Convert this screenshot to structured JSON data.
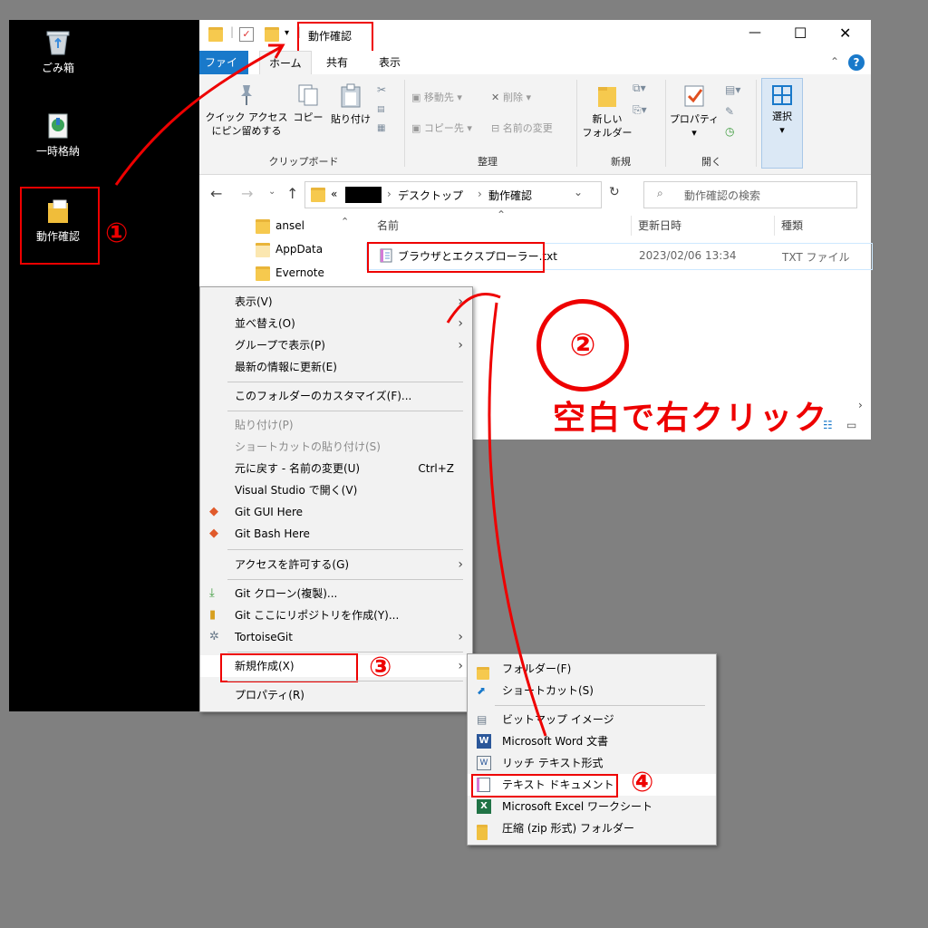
{
  "desktop": {
    "recycle_bin": "ごみ箱",
    "temp_storage": "一時格納",
    "folder": "動作確認"
  },
  "explorer": {
    "title": "動作確認",
    "controls": {
      "minimize": "—",
      "maximize": "☐",
      "close": "✕"
    },
    "tabs": [
      "ファイル",
      "ホーム",
      "共有",
      "表示"
    ],
    "ribbon": {
      "pin_quick_access": "クイック アクセス\nにピン留めする",
      "copy": "コピー",
      "paste": "貼り付け",
      "clipboard_group": "クリップボード",
      "move_to": "移動先",
      "delete": "削除",
      "copy_to": "コピー先",
      "rename": "名前の変更",
      "organize_group": "整理",
      "new_folder": "新しい\nフォルダー",
      "new_group": "新規",
      "properties": "プロパティ",
      "open_group": "開く",
      "select": "選択"
    },
    "address": {
      "prefix": "«",
      "crumbs": [
        "デスクトップ",
        "動作確認"
      ],
      "search_placeholder": "動作確認の検索"
    },
    "nav_items": [
      "ansel",
      "AppData",
      "Evernote"
    ],
    "columns": {
      "name": "名前",
      "modified": "更新日時",
      "type": "種類"
    },
    "file": {
      "name": "ブラウザとエクスプローラー.txt",
      "modified": "2023/02/06 13:34",
      "type": "TXT ファイル"
    }
  },
  "context_menu": [
    {
      "label": "表示(V)",
      "arrow": true
    },
    {
      "label": "並べ替え(O)",
      "arrow": true
    },
    {
      "label": "グループで表示(P)",
      "arrow": true
    },
    {
      "label": "最新の情報に更新(E)"
    },
    {
      "label": "このフォルダーのカスタマイズ(F)..."
    },
    {
      "label": "貼り付け(P)",
      "disabled": true
    },
    {
      "label": "ショートカットの貼り付け(S)",
      "disabled": true
    },
    {
      "label": "元に戻す - 名前の変更(U)",
      "shortcut": "Ctrl+Z"
    },
    {
      "label": "Visual Studio で開く(V)"
    },
    {
      "label": "Git GUI Here"
    },
    {
      "label": "Git Bash Here"
    },
    {
      "label": "アクセスを許可する(G)",
      "arrow": true
    },
    {
      "label": "Git クローン(複製)..."
    },
    {
      "label": "Git ここにリポジトリを作成(Y)..."
    },
    {
      "label": "TortoiseGit",
      "arrow": true
    },
    {
      "label": "新規作成(X)",
      "arrow": true
    },
    {
      "label": "プロパティ(R)"
    }
  ],
  "submenu": [
    {
      "label": "フォルダー(F)",
      "icon": "folder-icon"
    },
    {
      "label": "ショートカット(S)",
      "icon": "shortcut-icon"
    },
    {
      "label": "ビットマップ イメージ",
      "icon": "bitmap-icon"
    },
    {
      "label": "Microsoft Word 文書",
      "icon": "word-icon"
    },
    {
      "label": "リッチ テキスト形式",
      "icon": "rtf-icon"
    },
    {
      "label": "テキスト ドキュメント",
      "icon": "text-document-icon"
    },
    {
      "label": "Microsoft Excel ワークシート",
      "icon": "excel-icon"
    },
    {
      "label": "圧縮 (zip 形式) フォルダー",
      "icon": "zip-icon"
    }
  ],
  "annotations": {
    "step1": "①",
    "step2": "②",
    "step3": "③",
    "step4": "④",
    "instruction": "空白で右クリック"
  },
  "colors": {
    "annotation_red": "#e00000",
    "ribbon_accent": "#1979ca"
  }
}
